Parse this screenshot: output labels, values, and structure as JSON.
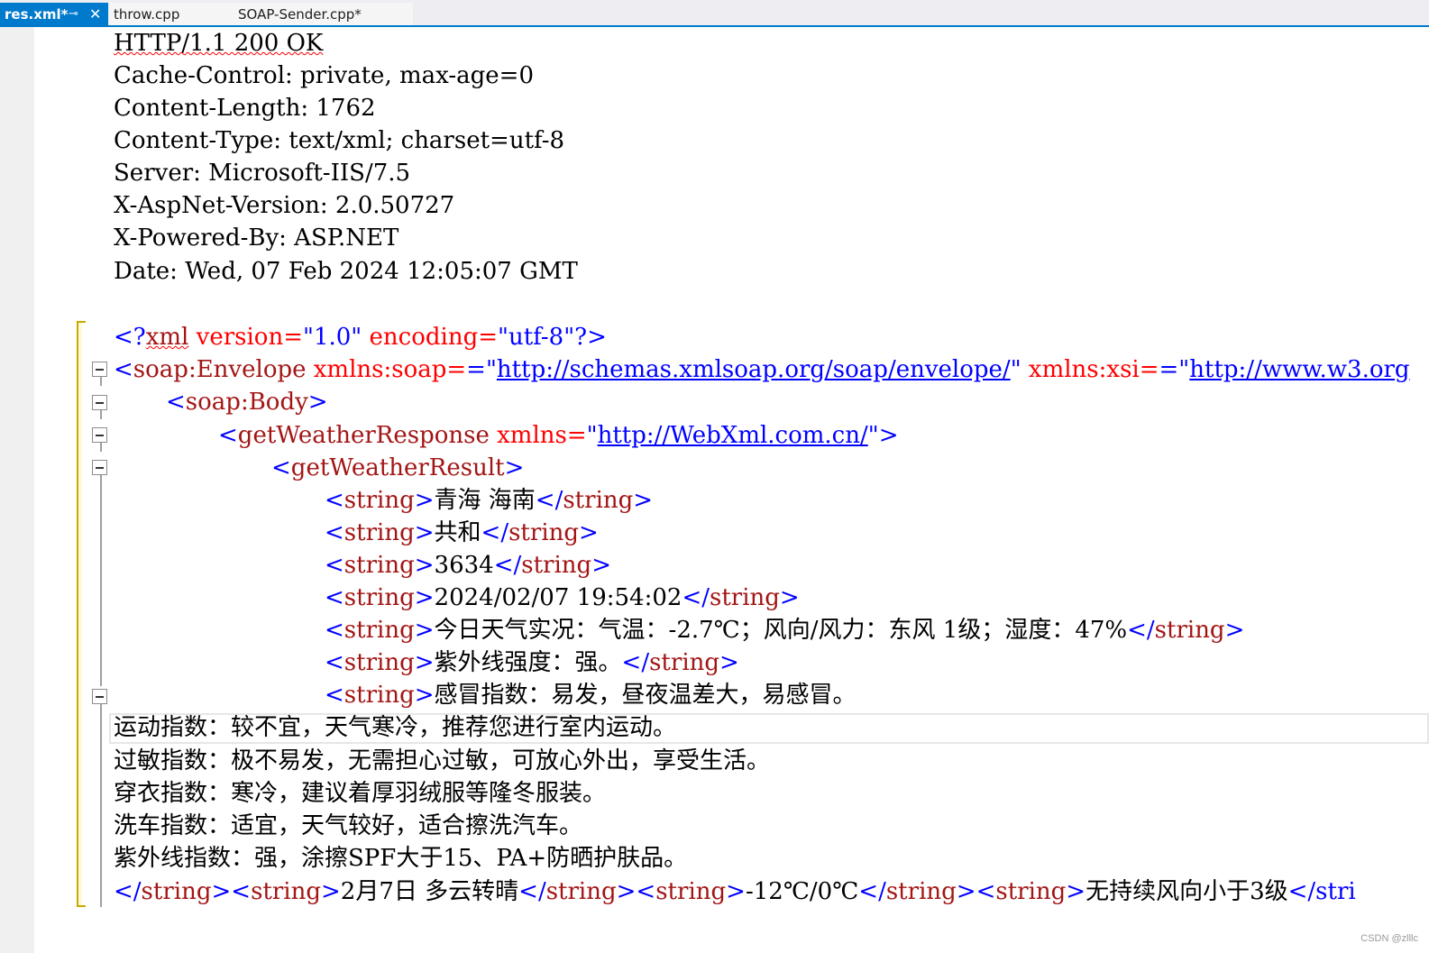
{
  "tabs": [
    {
      "label": "res.xml*",
      "active": true,
      "pin": "⊸",
      "close": "✕"
    },
    {
      "label": "throw.cpp",
      "active": false
    },
    {
      "label": "SOAP-Sender.cpp*",
      "active": false
    }
  ],
  "http_headers": [
    "HTTP/1.1 200 OK",
    "Cache-Control: private, max-age=0",
    "Content-Length: 1762",
    "Content-Type: text/xml; charset=utf-8",
    "Server: Microsoft-IIS/7.5",
    "X-AspNet-Version: 2.0.50727",
    "X-Powered-By: ASP.NET",
    "Date: Wed, 07 Feb 2024 12:05:07 GMT"
  ],
  "xml": {
    "decl_open": "<?",
    "decl_name": "xml",
    "decl_version_attr": " version=",
    "decl_version_val": "\"1.0\"",
    "decl_encoding_attr": " encoding=",
    "decl_encoding_val": "\"utf-8\"",
    "decl_close": "?>",
    "envelope_tag": "soap:Envelope",
    "envelope_attr1": " xmlns:soap=",
    "envelope_val1_q": "\"",
    "envelope_url1": "http://schemas.xmlsoap.org/soap/envelope/",
    "envelope_attr2": " xmlns:xsi=",
    "envelope_url2": "http://www.w3.org",
    "body_tag": "soap:Body",
    "response_tag": "getWeatherResponse",
    "response_attr": " xmlns=",
    "response_url": "http://WebXml.com.cn/",
    "result_tag": "getWeatherResult",
    "string_tag": "string",
    "strings": [
      "青海 海南",
      "共和",
      "3634",
      "2024/02/07 19:54:02",
      "今日天气实况：气温：-2.7℃；风向/风力：东风 1级；湿度：47%",
      "紫外线强度：强。"
    ],
    "multiline_start": "感冒指数：易发，昼夜温差大，易感冒。",
    "multiline_rest": [
      "运动指数：较不宜，天气寒冷，推荐您进行室内运动。",
      "过敏指数：极不易发，无需担心过敏，可放心外出，享受生活。",
      "穿衣指数：寒冷，建议着厚羽绒服等隆冬服装。",
      "洗车指数：适宜，天气较好，适合擦洗汽车。",
      "紫外线指数：强，涂擦SPF大于15、PA+防晒护肤品。"
    ],
    "last_line_values": [
      "2月7日 多云转晴",
      "-12℃/0℃",
      "无持续风向小于3级"
    ],
    "last_line_trailing": "</stri"
  },
  "watermark": "CSDN @zlllc"
}
